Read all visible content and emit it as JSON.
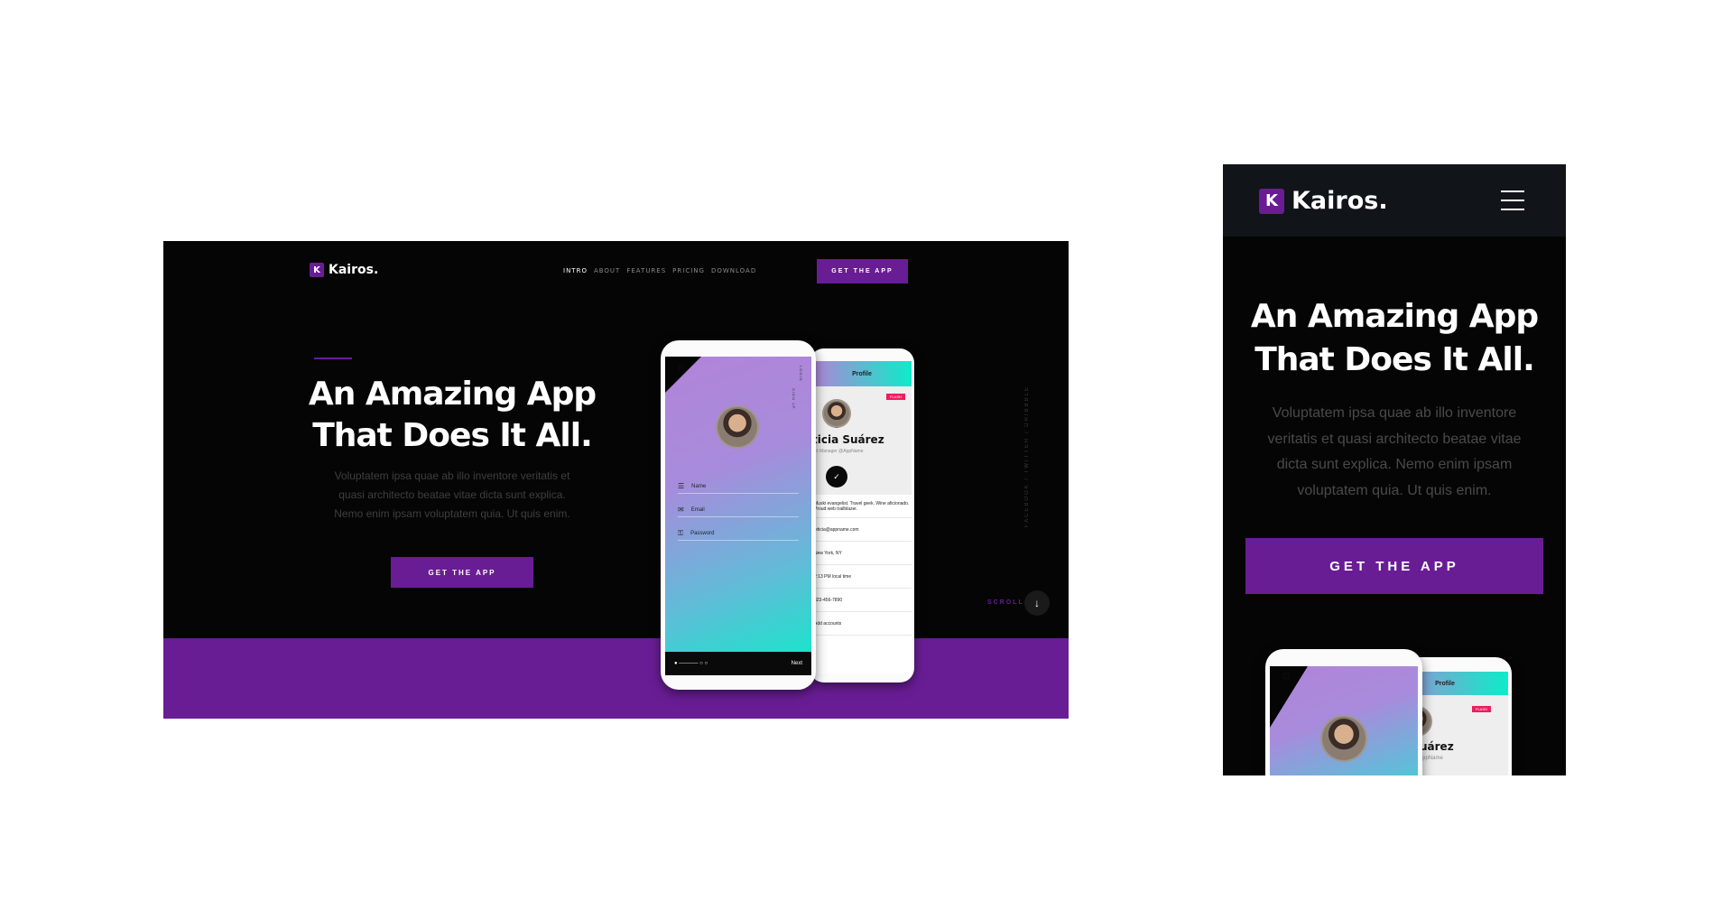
{
  "brand": {
    "logo_letter": "K",
    "name": "Kairos.",
    "accent": "#691d95"
  },
  "desktop": {
    "nav": [
      "INTRO",
      "ABOUT",
      "FEATURES",
      "PRICING",
      "DOWNLOAD"
    ],
    "nav_active": "INTRO",
    "cta_top": "GET THE APP",
    "title_line1": "An Amazing App",
    "title_line2": "That Does It All.",
    "text_line1": "Voluptatem ipsa quae ab illo inventore veritatis et",
    "text_line2": "quasi architecto beatae vitae dicta sunt explica.",
    "text_line3": "Nemo enim ipsam voluptatem quia. Ut quis enim.",
    "cta": "GET THE APP",
    "social": "FACEBOOK / TWITTER / DRIBBBLE",
    "scroll": "SCROLL",
    "scroll_icon": "↓"
  },
  "phone_login": {
    "side_label": "LOGIN",
    "side_label2": "SIGN UP",
    "fields": [
      {
        "icon": "☰",
        "label": "Name"
      },
      {
        "icon": "✉",
        "label": "Email"
      },
      {
        "icon": "⚿",
        "label": "Password"
      }
    ],
    "next": "Next"
  },
  "phone_profile": {
    "header": "Profile",
    "badge": "FLASH",
    "name": "ticia Suárez",
    "role": "uct Manager  @AppName",
    "check_icon": "✓",
    "rows": [
      "Muski evangelist. Travel geek. Wine aficionado. Proud web trailblazer.",
      "leticia@appname.com",
      "New York, NY",
      "2:13 PM local time",
      "323-456-7890",
      "Add accounts"
    ]
  },
  "mobile": {
    "title_line1": "An Amazing App",
    "title_line2": "That Does It All.",
    "text_line1": "Voluptatem ipsa quae ab illo inventore",
    "text_line2": "veritatis et quasi architecto beatae vitae",
    "text_line3": "dicta sunt explica. Nemo enim ipsam",
    "text_line4": "voluptatem quia. Ut quis enim.",
    "cta": "GET THE APP",
    "profile_header": "Profile",
    "profile_badge": "FLASH",
    "profile_name": "ticia Suárez",
    "profile_role": "uct Manager  @AppName"
  }
}
